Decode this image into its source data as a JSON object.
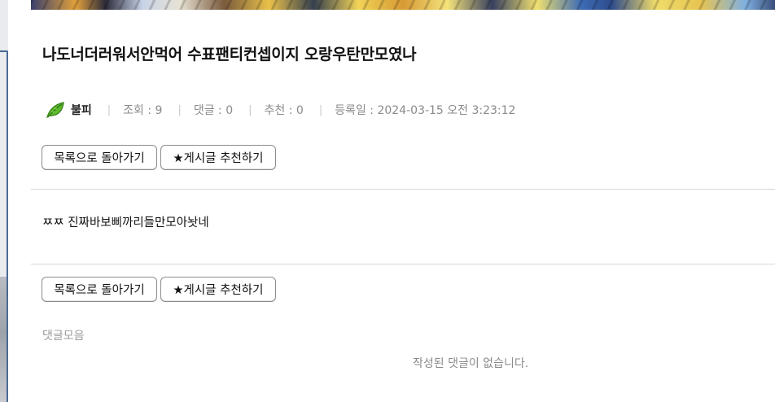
{
  "post": {
    "title": "나도너더러워서안먹어 수표팬티컨셉이지 오랑우탄만모였나",
    "author": "불피",
    "views": "조회 : 9",
    "comments_count": "댓글 : 0",
    "recommends": "추천 : 0",
    "date": "등록일 : 2024-03-15 오전 3:23:12",
    "body": "ㅉㅉ 진짜바보삐까리들만모아놧네"
  },
  "buttons": {
    "back_label": "목록으로 돌아가기",
    "recommend_label": "★게시글 추천하기"
  },
  "comments": {
    "heading": "댓글모음",
    "empty_text": "작성된 댓글이 없습니다."
  },
  "icons": {
    "author_badge": "leaf-icon",
    "recommend": "star-icon"
  },
  "colors": {
    "leaf_green": "#4caf27",
    "panel_border": "#4a6a95",
    "meta_gray": "#8a8a8a",
    "divider": "#d6d6d6"
  }
}
